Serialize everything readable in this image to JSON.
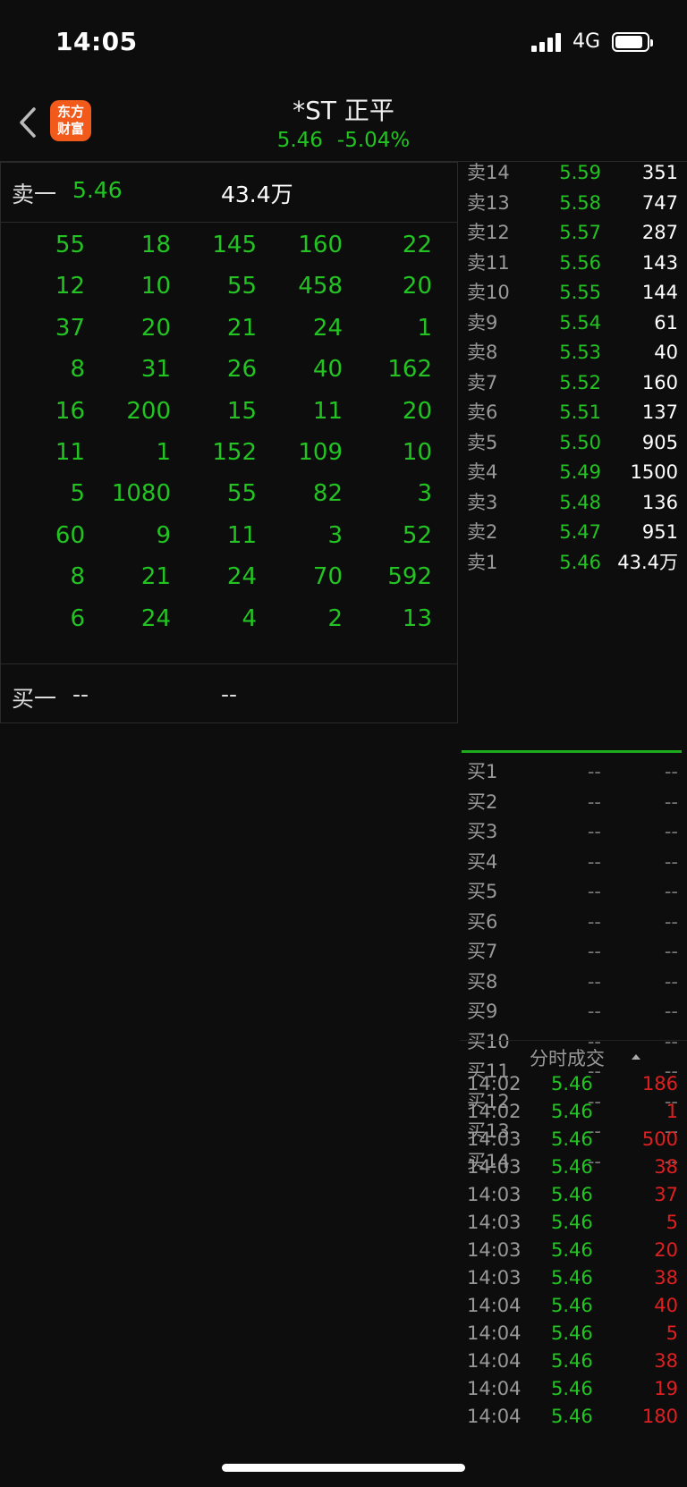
{
  "status_bar": {
    "time": "14:05",
    "network": "4G"
  },
  "header": {
    "logo_text": "东方\n财富",
    "stock_name": "*ST 正平",
    "price": "5.46",
    "change_pct": "-5.04%"
  },
  "left_panel": {
    "sell_one": {
      "label": "卖一",
      "price": "5.46",
      "volume": "43.4万"
    },
    "grid": [
      [
        "55",
        "18",
        "145",
        "160",
        "22"
      ],
      [
        "12",
        "10",
        "55",
        "458",
        "20"
      ],
      [
        "37",
        "20",
        "21",
        "24",
        "1"
      ],
      [
        "8",
        "31",
        "26",
        "40",
        "162"
      ],
      [
        "16",
        "200",
        "15",
        "11",
        "20"
      ],
      [
        "11",
        "1",
        "152",
        "109",
        "10"
      ],
      [
        "5",
        "1080",
        "55",
        "82",
        "3"
      ],
      [
        "60",
        "9",
        "11",
        "3",
        "52"
      ],
      [
        "8",
        "21",
        "24",
        "70",
        "592"
      ],
      [
        "6",
        "24",
        "4",
        "2",
        "13"
      ]
    ],
    "buy_one": {
      "label": "买一",
      "price": "--",
      "volume": "--"
    }
  },
  "order_book": {
    "sells": [
      {
        "label": "卖14",
        "price": "5.59",
        "volume": "351"
      },
      {
        "label": "卖13",
        "price": "5.58",
        "volume": "747"
      },
      {
        "label": "卖12",
        "price": "5.57",
        "volume": "287"
      },
      {
        "label": "卖11",
        "price": "5.56",
        "volume": "143"
      },
      {
        "label": "卖10",
        "price": "5.55",
        "volume": "144"
      },
      {
        "label": "卖9",
        "price": "5.54",
        "volume": "61"
      },
      {
        "label": "卖8",
        "price": "5.53",
        "volume": "40"
      },
      {
        "label": "卖7",
        "price": "5.52",
        "volume": "160"
      },
      {
        "label": "卖6",
        "price": "5.51",
        "volume": "137"
      },
      {
        "label": "卖5",
        "price": "5.50",
        "volume": "905"
      },
      {
        "label": "卖4",
        "price": "5.49",
        "volume": "1500"
      },
      {
        "label": "卖3",
        "price": "5.48",
        "volume": "136"
      },
      {
        "label": "卖2",
        "price": "5.47",
        "volume": "951"
      },
      {
        "label": "卖1",
        "price": "5.46",
        "volume": "43.4万"
      }
    ],
    "buys": [
      {
        "label": "买1",
        "price": "--",
        "volume": "--"
      },
      {
        "label": "买2",
        "price": "--",
        "volume": "--"
      },
      {
        "label": "买3",
        "price": "--",
        "volume": "--"
      },
      {
        "label": "买4",
        "price": "--",
        "volume": "--"
      },
      {
        "label": "买5",
        "price": "--",
        "volume": "--"
      },
      {
        "label": "买6",
        "price": "--",
        "volume": "--"
      },
      {
        "label": "买7",
        "price": "--",
        "volume": "--"
      },
      {
        "label": "买8",
        "price": "--",
        "volume": "--"
      },
      {
        "label": "买9",
        "price": "--",
        "volume": "--"
      },
      {
        "label": "买10",
        "price": "--",
        "volume": "--"
      },
      {
        "label": "买11",
        "price": "--",
        "volume": "--"
      },
      {
        "label": "买12",
        "price": "--",
        "volume": "--"
      },
      {
        "label": "买13",
        "price": "--",
        "volume": "--"
      },
      {
        "label": "买14",
        "price": "--",
        "volume": "--"
      }
    ]
  },
  "ticks": {
    "title": "分时成交",
    "rows": [
      {
        "time": "14:02",
        "price": "5.46",
        "volume": "186"
      },
      {
        "time": "14:02",
        "price": "5.46",
        "volume": "1"
      },
      {
        "time": "14:03",
        "price": "5.46",
        "volume": "500"
      },
      {
        "time": "14:03",
        "price": "5.46",
        "volume": "38"
      },
      {
        "time": "14:03",
        "price": "5.46",
        "volume": "37"
      },
      {
        "time": "14:03",
        "price": "5.46",
        "volume": "5"
      },
      {
        "time": "14:03",
        "price": "5.46",
        "volume": "20"
      },
      {
        "time": "14:03",
        "price": "5.46",
        "volume": "38"
      },
      {
        "time": "14:04",
        "price": "5.46",
        "volume": "40"
      },
      {
        "time": "14:04",
        "price": "5.46",
        "volume": "5"
      },
      {
        "time": "14:04",
        "price": "5.46",
        "volume": "38"
      },
      {
        "time": "14:04",
        "price": "5.46",
        "volume": "19"
      },
      {
        "time": "14:04",
        "price": "5.46",
        "volume": "180"
      }
    ]
  },
  "colors": {
    "up": "#e02020",
    "down": "#22c322",
    "background": "#0d0d0d",
    "brand": "#f25a1c"
  }
}
